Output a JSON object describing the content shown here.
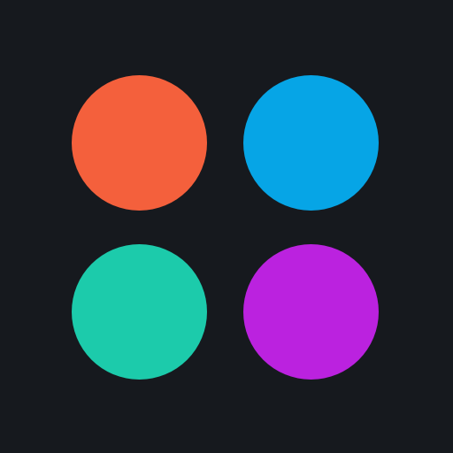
{
  "background_color": "#16191e",
  "dots": [
    {
      "name": "orange",
      "color": "#f4603c"
    },
    {
      "name": "blue",
      "color": "#06a5e6"
    },
    {
      "name": "teal",
      "color": "#1ccbab"
    },
    {
      "name": "purple",
      "color": "#bb22df"
    }
  ]
}
